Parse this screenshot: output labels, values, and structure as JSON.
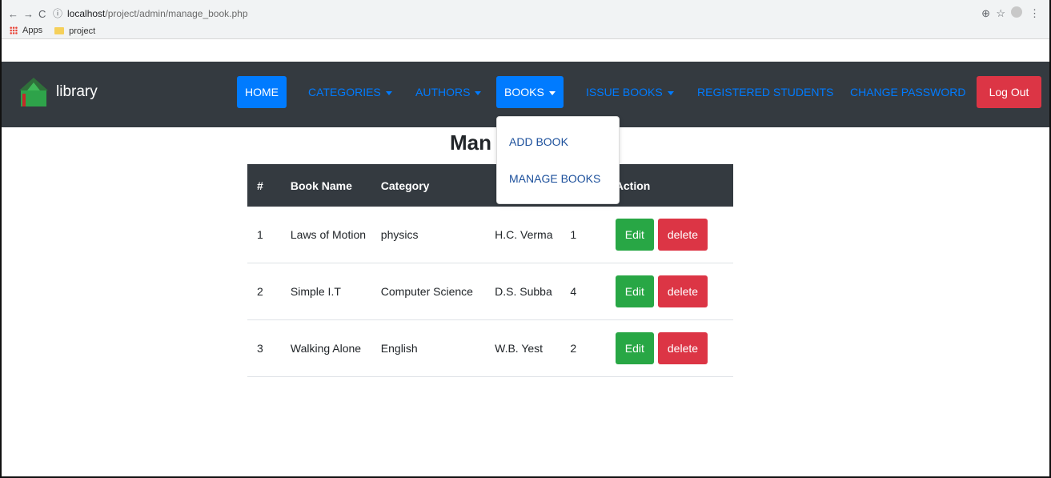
{
  "browser": {
    "url_host": "localhost",
    "url_path": "/project/admin/manage_book.php",
    "bookmarks": [
      "Apps",
      "project"
    ]
  },
  "navbar": {
    "brand": "library",
    "items": [
      "HOME",
      "CATEGORIES",
      "AUTHORS",
      "BOOKS",
      "ISSUE BOOKS",
      "REGISTERED STUDENTS",
      "CHANGE PASSWORD"
    ],
    "logout": "Log Out"
  },
  "dropdown": {
    "items": [
      "ADD BOOK",
      "MANAGE BOOKS"
    ]
  },
  "page": {
    "title_visible": "Man"
  },
  "table": {
    "headers": [
      "#",
      "Book Name",
      "Category",
      "",
      "",
      "Action"
    ],
    "rows": [
      {
        "num": "1",
        "book": "Laws of Motion",
        "category": "physics",
        "author": "H.C. Verma",
        "qty": "1"
      },
      {
        "num": "2",
        "book": "Simple I.T",
        "category": "Computer Science",
        "author": "D.S. Subba",
        "qty": "4"
      },
      {
        "num": "3",
        "book": "Walking Alone",
        "category": "English",
        "author": "W.B. Yest",
        "qty": "2"
      }
    ],
    "edit_label": "Edit",
    "delete_label": "delete"
  },
  "colors": {
    "primary": "#007bff",
    "danger": "#dc3545",
    "success": "#28a745",
    "navbar_bg": "#343a40"
  }
}
